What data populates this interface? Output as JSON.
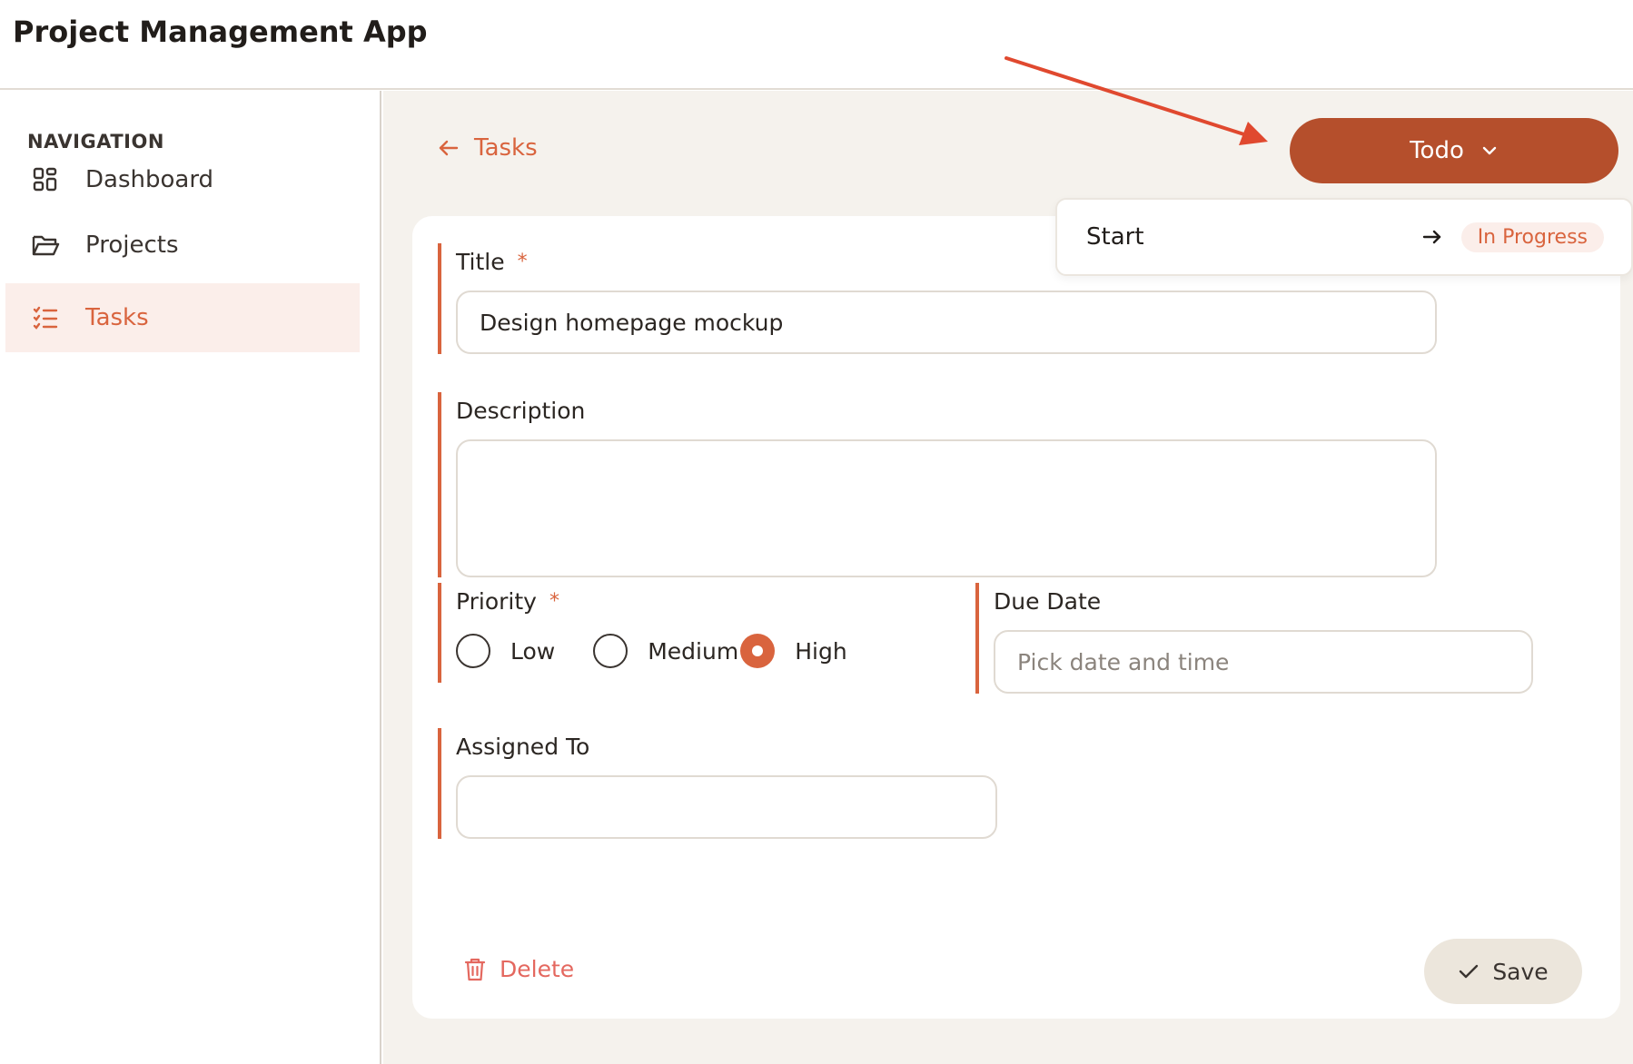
{
  "app": {
    "title": "Project Management App"
  },
  "sidebar": {
    "heading": "NAVIGATION",
    "items": [
      {
        "label": "Dashboard",
        "icon": "dashboard-icon",
        "active": false
      },
      {
        "label": "Projects",
        "icon": "folder-icon",
        "active": false
      },
      {
        "label": "Tasks",
        "icon": "tasks-list-icon",
        "active": true
      }
    ]
  },
  "main": {
    "back_label": "Tasks",
    "status_button": {
      "label": "Todo"
    },
    "status_menu": {
      "items": [
        {
          "label": "Start",
          "target": "In Progress"
        }
      ]
    },
    "form": {
      "title": {
        "label": "Title",
        "required_mark": "*",
        "value": "Design homepage mockup"
      },
      "description": {
        "label": "Description",
        "value": ""
      },
      "priority": {
        "label": "Priority",
        "required_mark": "*",
        "options": [
          "Low",
          "Medium",
          "High"
        ],
        "selected": "High"
      },
      "due_date": {
        "label": "Due Date",
        "placeholder": "Pick date and time"
      },
      "assigned_to": {
        "label": "Assigned To",
        "value": ""
      },
      "delete_label": "Delete",
      "save_label": "Save"
    }
  },
  "colors": {
    "accent": "#d9643e",
    "status_button": "#b54f2c",
    "active_nav_bg": "#fbeeea",
    "main_bg": "#f5f2ed",
    "delete": "#e4685f",
    "annotation_arrow": "#e0492f"
  }
}
